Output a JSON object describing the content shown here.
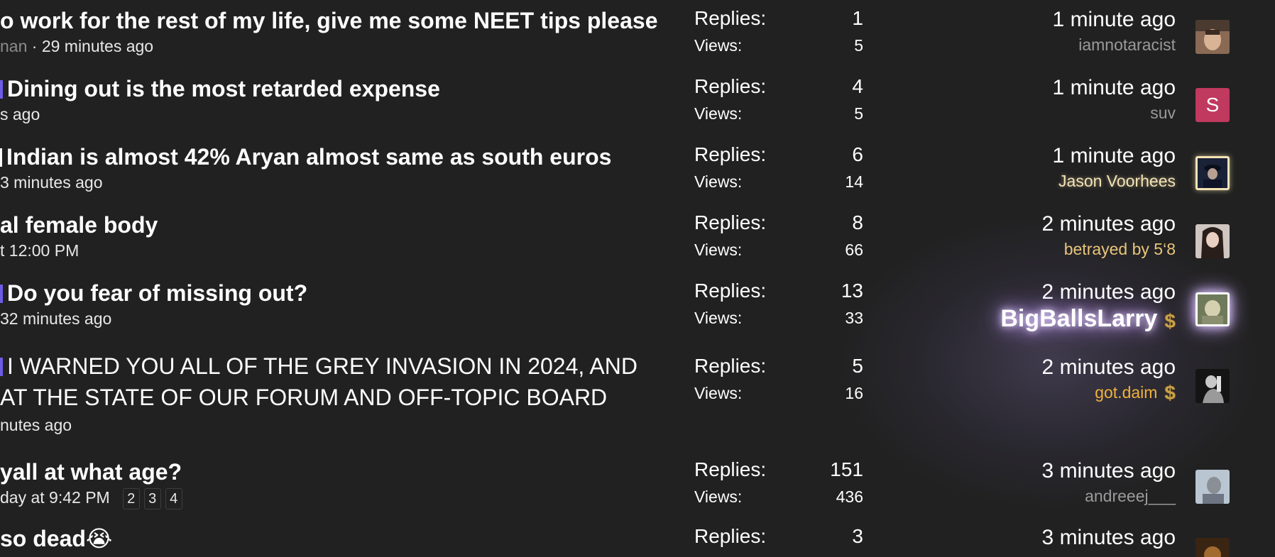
{
  "labels": {
    "replies": "Replies:",
    "views": "Views:"
  },
  "threads": [
    {
      "title": "o work for the rest of my life, give me some NEET tips please",
      "meta_prefix": "nan",
      "meta_rest": " · 29 minutes ago",
      "replies": "1",
      "views": "5",
      "last_time": "1 minute ago",
      "last_user": "iamnotaracist",
      "avatar": "photo-avatar"
    },
    {
      "title": "Dining out is the most retarded expense",
      "meta_prefix": "",
      "meta_rest": "s ago",
      "replies": "4",
      "views": "5",
      "last_time": "1 minute ago",
      "last_user": "suv",
      "avatar_letter": "S"
    },
    {
      "title": "Indian is almost 42% Aryan almost same as south euros",
      "meta_prefix": "",
      "meta_rest": "3 minutes ago",
      "replies": "6",
      "views": "14",
      "last_time": "1 minute ago",
      "last_user": "Jason Voorhees",
      "avatar": "photo-avatar"
    },
    {
      "title": "al female body",
      "meta_prefix": "",
      "meta_rest": "t 12:00 PM",
      "replies": "8",
      "views": "66",
      "last_time": "2 minutes ago",
      "last_user": "betrayed by 5‘8",
      "avatar": "photo-avatar"
    },
    {
      "title": "Do you fear of missing out?",
      "meta_prefix": "",
      "meta_rest": "32 minutes ago",
      "replies": "13",
      "views": "33",
      "last_time": "2 minutes ago",
      "last_user": "BigBallsLarry",
      "last_user_badge": "$",
      "avatar": "photo-avatar"
    },
    {
      "title_line1": "I WARNED YOU ALL OF THE GREY INVASION IN 2024, AND",
      "title_line2": "AT THE STATE OF OUR FORUM AND OFF-TOPIC BOARD",
      "meta_prefix": "",
      "meta_rest": "nutes ago",
      "replies": "5",
      "views": "16",
      "last_time": "2 minutes ago",
      "last_user": "got.daim",
      "last_user_badge": "$",
      "avatar": "photo-avatar"
    },
    {
      "title": "yall at what age?",
      "meta_prefix": "",
      "meta_rest": "day at 9:42 PM",
      "pages": [
        "2",
        "3",
        "4"
      ],
      "replies": "151",
      "views": "436",
      "last_time": "3 minutes ago",
      "last_user": "andreeej___",
      "avatar": "photo-avatar"
    },
    {
      "title": "so dead😭",
      "replies": "3",
      "last_time": "3 minutes ago",
      "avatar": "photo-avatar"
    }
  ],
  "colors": {
    "background": "#212121",
    "prefix_accent": "#6c5ce7",
    "avatar_letter_bg": "#c0395e",
    "gold_user": "#e8c57a",
    "glow": "#c8a6ff"
  }
}
